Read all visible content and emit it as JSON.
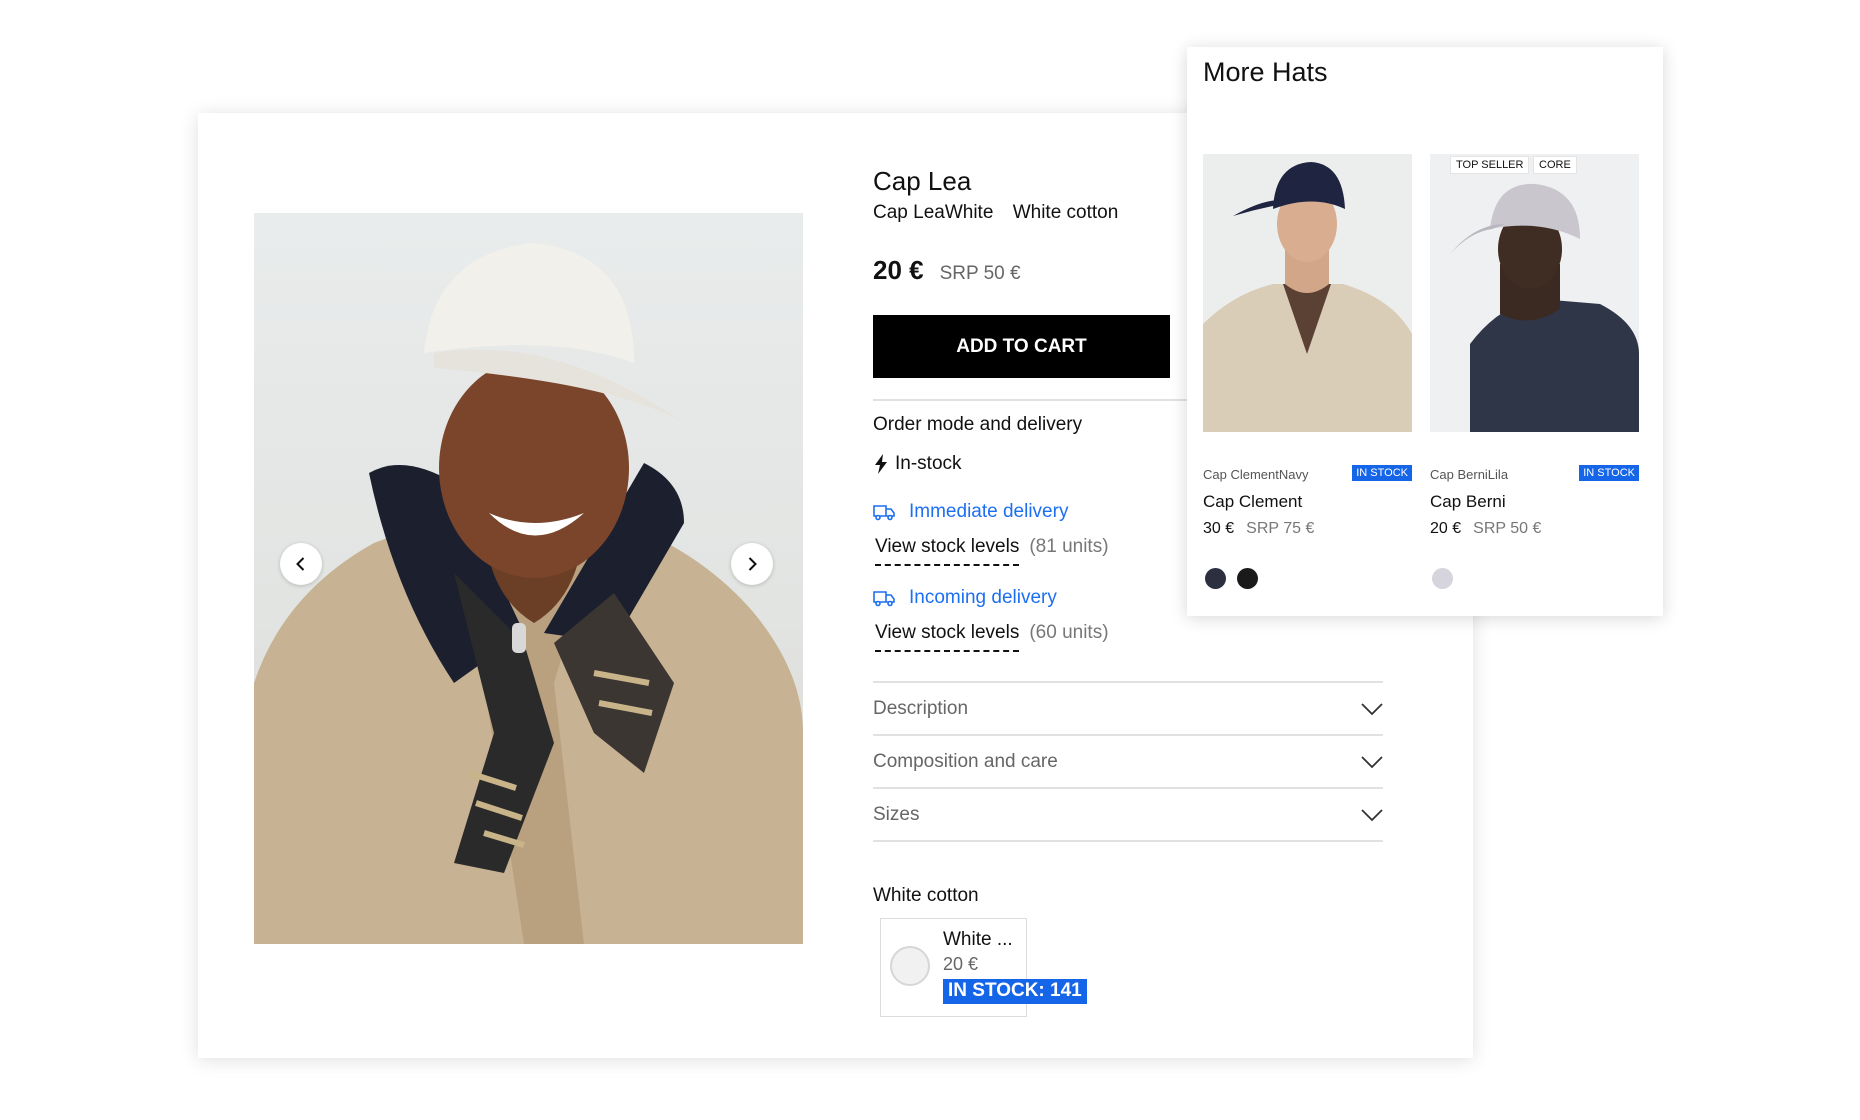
{
  "product": {
    "title": "Cap Lea",
    "variant_name": "Cap LeaWhite",
    "variant_color": "White cotton",
    "price": "20 €",
    "srp": "SRP 50 €",
    "add_to_cart": "ADD TO CART",
    "order_mode_title": "Order mode and delivery",
    "in_stock_label": "In-stock",
    "immediate_delivery": "Immediate delivery",
    "immediate_stock_link": "View stock levels",
    "immediate_units": "(81 units)",
    "incoming_delivery": "Incoming delivery",
    "incoming_stock_link": "View stock levels",
    "incoming_units": "(60 units)",
    "accordion": [
      {
        "label": "Description"
      },
      {
        "label": "Composition and care"
      },
      {
        "label": "Sizes"
      }
    ],
    "color_section_title": "White cotton",
    "swatch": {
      "name": "White ...",
      "price": "20 €",
      "stock": "IN STOCK: 141"
    }
  },
  "gallery": {
    "prev_icon": "chevron-left-icon",
    "next_icon": "chevron-right-icon"
  },
  "more_hats": {
    "title": "More Hats",
    "items": [
      {
        "subtitle": "Cap ClementNavy",
        "badge": "IN STOCK",
        "name": "Cap Clement",
        "price": "30 €",
        "srp": "SRP 75 €",
        "tags": [],
        "colors": [
          "#2b2f3f",
          "#1a1a1a"
        ]
      },
      {
        "subtitle": "Cap BerniLila",
        "badge": "IN STOCK",
        "name": "Cap Berni",
        "price": "20 €",
        "srp": "SRP 50 €",
        "tags": [
          "TOP SELLER",
          "CORE"
        ],
        "colors": [
          "#d6d4dc"
        ]
      }
    ]
  },
  "colors": {
    "accent_blue": "#1565e8",
    "link_blue": "#1d6ff2",
    "button_black": "#000000"
  }
}
